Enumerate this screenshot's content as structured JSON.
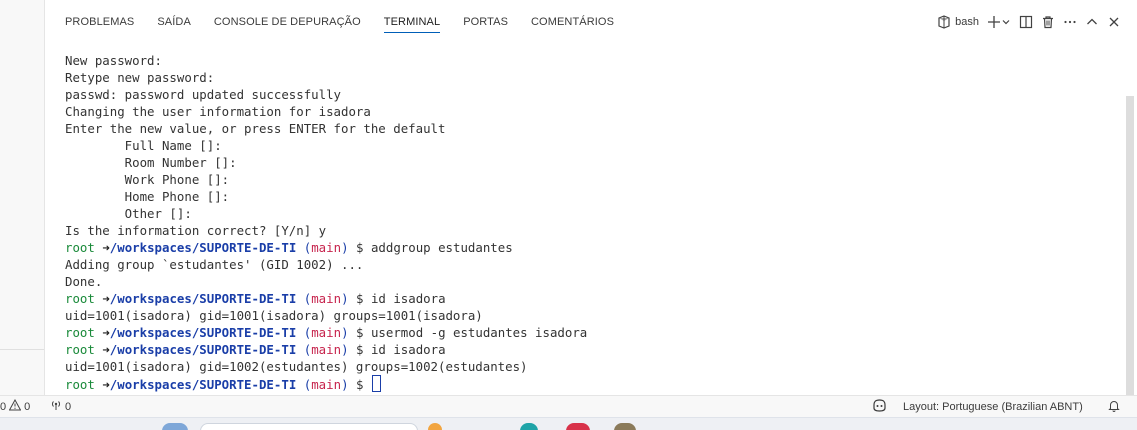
{
  "tabs": [
    {
      "label": "PROBLEMAS"
    },
    {
      "label": "SAÍDA"
    },
    {
      "label": "CONSOLE DE DEPURAÇÃO"
    },
    {
      "label": "TERMINAL"
    },
    {
      "label": "PORTAS"
    },
    {
      "label": "COMENTÁRIOS"
    }
  ],
  "actions": {
    "shell": "bash",
    "terminal_icon": "terminal-icon",
    "add_icon": "plus-icon",
    "dropdown_icon": "chevron-down-icon",
    "split_icon": "split-icon",
    "trash_icon": "trash-icon",
    "more_icon": "ellipsis-icon",
    "maximize_icon": "chevron-up-icon",
    "close_icon": "close-icon"
  },
  "terminal": {
    "plain_lines": [
      "New password:",
      "Retype new password:",
      "passwd: password updated successfully",
      "Changing the user information for isadora",
      "Enter the new value, or press ENTER for the default",
      "\tFull Name []:",
      "\tRoom Number []:",
      "\tWork Phone []:",
      "\tHome Phone []:",
      "\tOther []:",
      "Is the information correct? [Y/n] y"
    ],
    "prompt": {
      "user": "root",
      "arrow": "➜",
      "path": "/workspaces/SUPORTE-DE-TI",
      "branch": "main",
      "symbol": "$"
    },
    "entries": [
      {
        "command": "addgroup estudantes",
        "output": [
          "Adding group `estudantes' (GID 1002) ...",
          "Done."
        ]
      },
      {
        "command": "id isadora",
        "output": [
          "uid=1001(isadora) gid=1001(isadora) groups=1001(isadora)"
        ]
      },
      {
        "command": "usermod -g estudantes isadora",
        "output": []
      },
      {
        "command": "id isadora",
        "output": [
          "uid=1001(isadora) gid=1002(estudantes) groups=1002(estudantes)"
        ]
      },
      {
        "command": "",
        "output": []
      }
    ]
  },
  "statusbar": {
    "errors": "0",
    "warnings": "0",
    "ports": "0",
    "layout": "Layout: Portuguese (Brazilian ABNT)",
    "copilot_icon": "copilot-icon",
    "bell_icon": "bell-icon"
  },
  "colors": {
    "accent": "#005fb8",
    "prompt_user": "#1a8a3a",
    "prompt_path": "#1a3ea8",
    "prompt_branch": "#c7254e"
  }
}
